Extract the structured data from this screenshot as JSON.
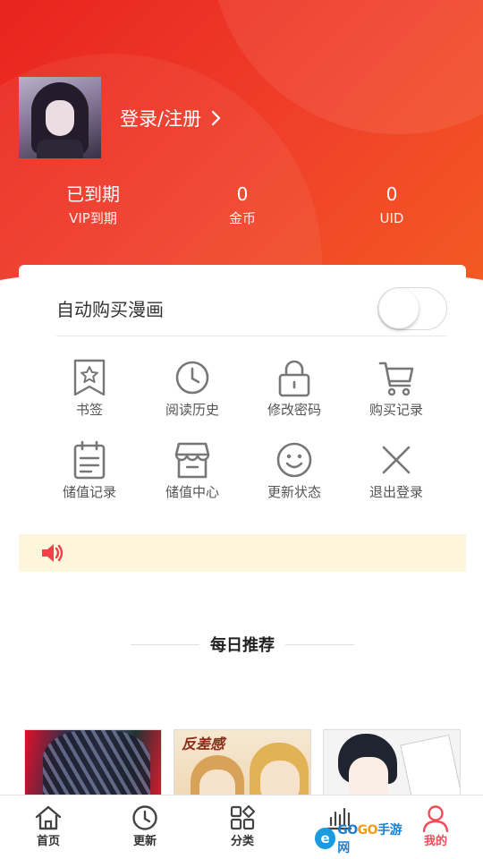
{
  "header": {
    "login_label": "登录/注册",
    "stats": [
      {
        "value": "已到期",
        "label": "VIP到期"
      },
      {
        "value": "0",
        "label": "金币"
      },
      {
        "value": "0",
        "label": "UID"
      }
    ]
  },
  "card": {
    "auto_buy_label": "自动购买漫画",
    "auto_buy_on": false,
    "menu": [
      {
        "label": "书签",
        "icon": "bookmark-icon"
      },
      {
        "label": "阅读历史",
        "icon": "clock-icon"
      },
      {
        "label": "修改密码",
        "icon": "lock-icon"
      },
      {
        "label": "购买记录",
        "icon": "cart-icon"
      },
      {
        "label": "储值记录",
        "icon": "clipboard-icon"
      },
      {
        "label": "储值中心",
        "icon": "store-icon"
      },
      {
        "label": "更新状态",
        "icon": "smiley-icon"
      },
      {
        "label": "退出登录",
        "icon": "close-icon"
      }
    ]
  },
  "notice": {
    "icon": "speaker-icon",
    "color": "#f0404a"
  },
  "section": {
    "title": "每日推荐"
  },
  "thumb2_logo": "反差感",
  "tabbar": {
    "tabs": [
      {
        "label": "首页",
        "icon": "home-icon"
      },
      {
        "label": "更新",
        "icon": "clock-icon"
      },
      {
        "label": "分类",
        "icon": "grid-icon"
      },
      {
        "label": "",
        "icon": "chart-icon"
      },
      {
        "label": "我的",
        "icon": "user-icon"
      }
    ],
    "active_color": "#f04d58"
  },
  "watermark": {
    "e": "e",
    "go1": "GO",
    "go2": "GO",
    "suffix": "手游网"
  },
  "colors": {
    "header": "#ee3325",
    "notice_bg": "#fdf6dc",
    "accent": "#f04d58"
  }
}
